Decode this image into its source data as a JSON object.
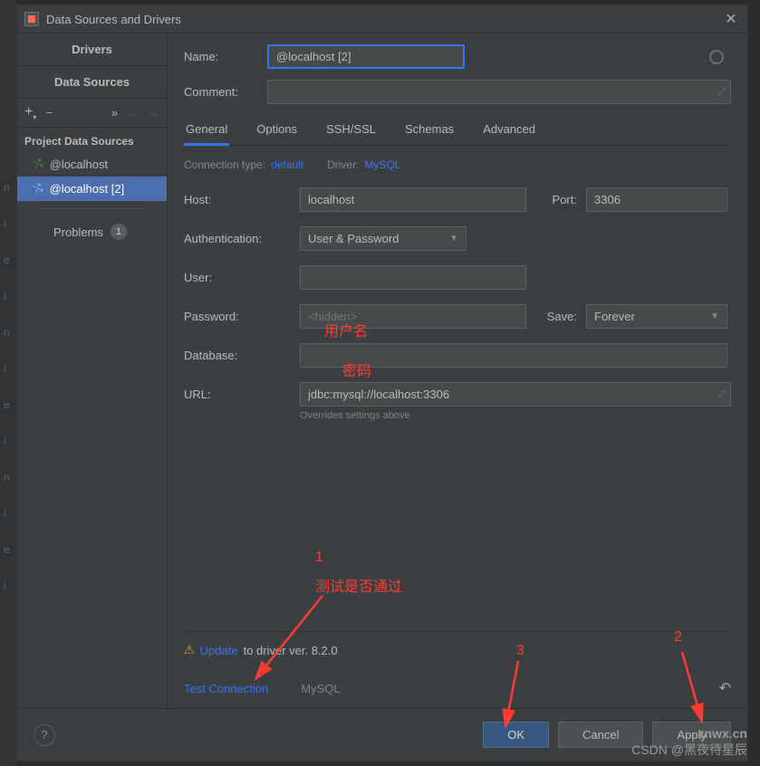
{
  "window": {
    "title": "Data Sources and Drivers"
  },
  "leftTabs": {
    "drivers": "Drivers",
    "dataSources": "Data Sources"
  },
  "toolbar": {
    "add": "+",
    "remove": "−",
    "more": "»",
    "back": "←",
    "fwd": "→"
  },
  "sectionHeader": "Project Data Sources",
  "tree": {
    "item0": "@localhost",
    "item1": "@localhost [2]"
  },
  "problems": {
    "label": "Problems",
    "count": "1"
  },
  "form": {
    "nameLabel": "Name:",
    "nameValue": "@localhost [2]",
    "commentLabel": "Comment:"
  },
  "tabs": {
    "general": "General",
    "options": "Options",
    "ssh": "SSH/SSL",
    "schemas": "Schemas",
    "advanced": "Advanced"
  },
  "conn": {
    "typeLabel": "Connection type:",
    "typeValue": "default",
    "driverLabel": "Driver:",
    "driverValue": "MySQL"
  },
  "fields": {
    "hostLabel": "Host:",
    "hostValue": "localhost",
    "portLabel": "Port:",
    "portValue": "3306",
    "authLabel": "Authentication:",
    "authValue": "User & Password",
    "userLabel": "User:",
    "userValue": "",
    "passLabel": "Password:",
    "passPlaceholder": "<hidden>",
    "saveLabel": "Save:",
    "saveValue": "Forever",
    "dbLabel": "Database:",
    "dbValue": "",
    "urlLabel": "URL:",
    "urlValue": "jdbc:mysql://localhost:3306",
    "urlHint": "Overrides settings above"
  },
  "update": {
    "icon": "⚠",
    "link": "Update",
    "rest": " to driver ver. 8.2.0"
  },
  "test": {
    "link": "Test Connection",
    "driver": "MySQL"
  },
  "footer": {
    "ok": "OK",
    "cancel": "Cancel",
    "apply": "Apply"
  },
  "annotations": {
    "user": "用户名",
    "pass": "密码",
    "n1": "1",
    "t1": "测试是否通过",
    "n2": "2",
    "n3": "3"
  },
  "watermark": {
    "line1": "znwx.cn",
    "line2": "CSDN @黑夜待星辰"
  }
}
